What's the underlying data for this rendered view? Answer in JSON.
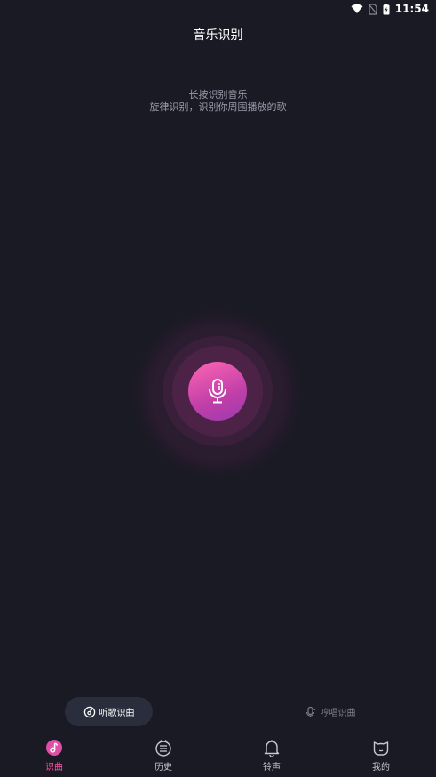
{
  "status_bar": {
    "time": "11:54"
  },
  "header": {
    "title": "音乐识别"
  },
  "hint": {
    "line1": "长按识别音乐",
    "line2": "旋律识别，识别你周围播放的歌"
  },
  "record": {
    "icon": "microphone-icon"
  },
  "modes": [
    {
      "label": "听歌识曲",
      "icon": "music-disc-icon",
      "active": true
    },
    {
      "label": "哼唱识曲",
      "icon": "mic-note-icon",
      "active": false
    }
  ],
  "nav": {
    "items": [
      {
        "label": "识曲",
        "icon": "music-note-icon",
        "active": true
      },
      {
        "label": "历史",
        "icon": "history-list-icon",
        "active": false
      },
      {
        "label": "铃声",
        "icon": "bell-icon",
        "active": false
      },
      {
        "label": "我的",
        "icon": "cat-face-icon",
        "active": false
      }
    ]
  },
  "colors": {
    "background": "#1a1a24",
    "accent": "#ff4fa3",
    "pill": "#2a2d3c",
    "muted_text": "#9a9aaa"
  }
}
